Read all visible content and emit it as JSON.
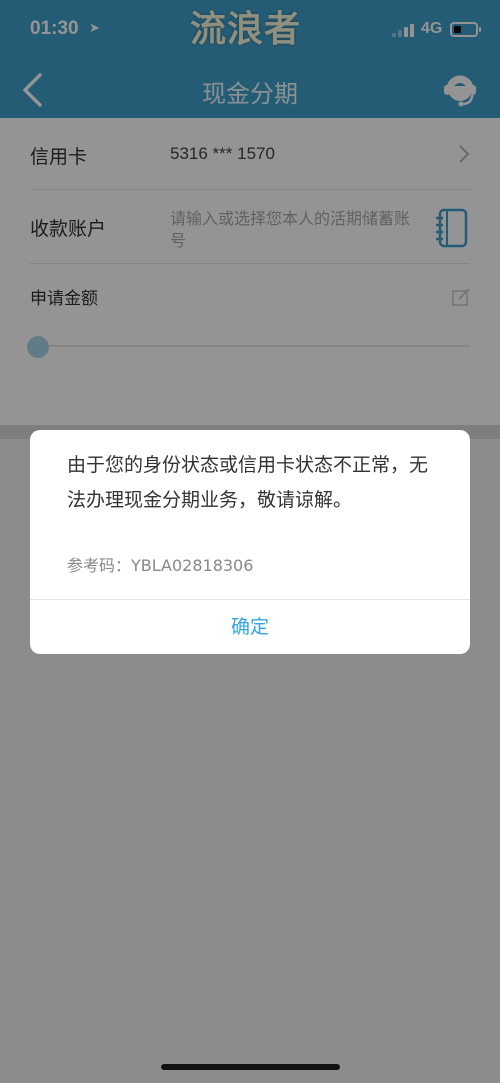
{
  "status": {
    "time": "01:30",
    "network": "4G",
    "watermark": "流浪者"
  },
  "nav": {
    "title": "现金分期",
    "back_icon": "chevron-left-icon",
    "service_icon": "customer-service-icon"
  },
  "form": {
    "card_label": "信用卡",
    "card_number": "5316 *** 1570",
    "account_label": "收款账户",
    "account_placeholder": "请输入或选择您本人的活期储蓄账号",
    "amount_label": "申请金额",
    "slider_value": 0
  },
  "dialog": {
    "message": "由于您的身份状态或信用卡状态不正常，无法办理现金分期业务，敬请谅解。",
    "reference": "参考码：YBLA02818306",
    "confirm_label": "确定"
  },
  "colors": {
    "primary": "#3f9fcc",
    "accent": "#2ea7dd"
  }
}
